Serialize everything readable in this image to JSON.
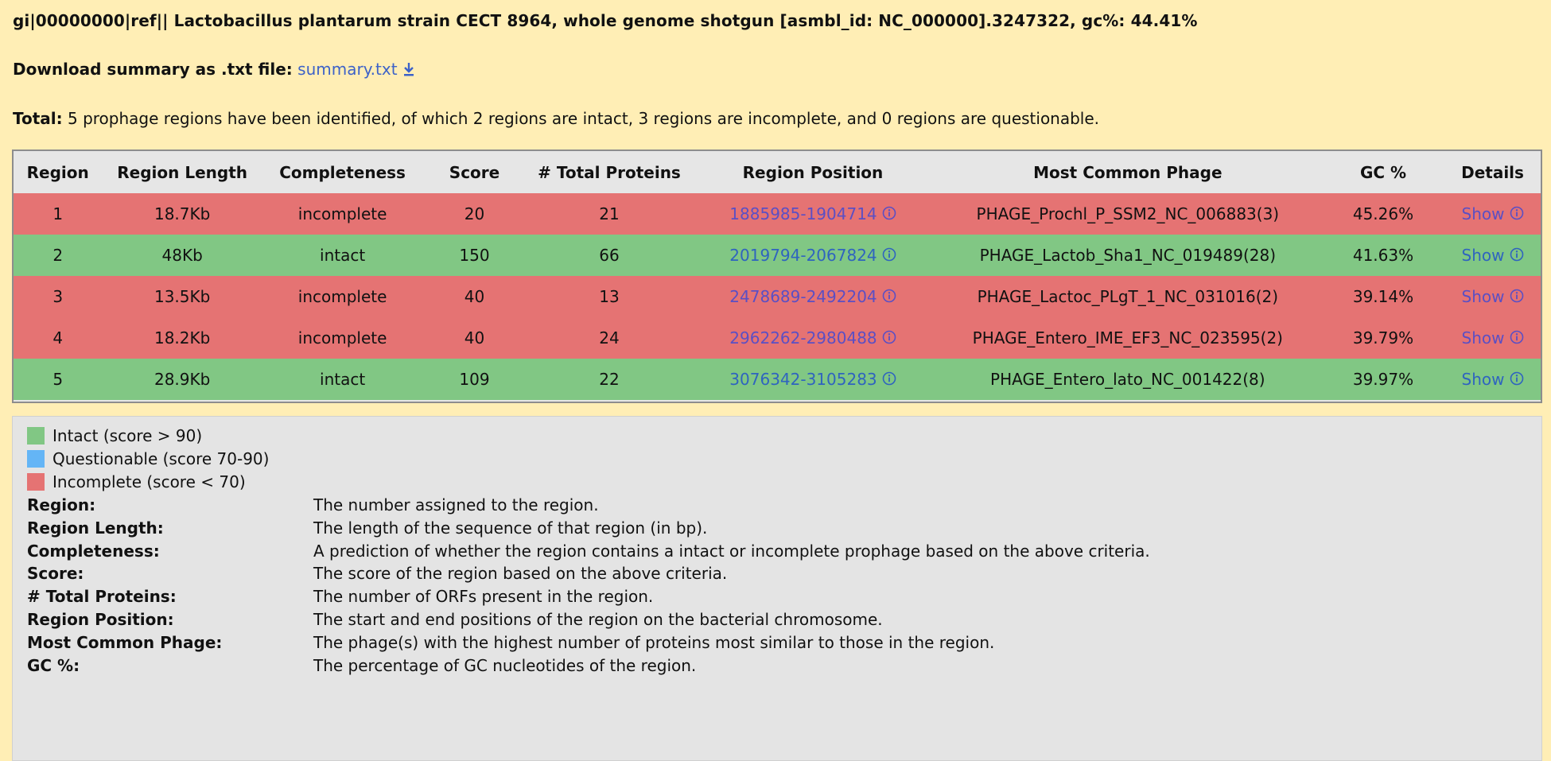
{
  "header": {
    "title": "gi|00000000|ref|| Lactobacillus plantarum strain CECT 8964, whole genome shotgun [asmbl_id: NC_000000].3247322, gc%: 44.41%",
    "download_label": "Download summary as .txt file:",
    "download_link": "summary.txt",
    "total_label": "Total:",
    "total_text": " 5 prophage regions have been identified, of which 2 regions are intact, 3 regions are incomplete, and 0 regions are questionable."
  },
  "table": {
    "columns": [
      "Region",
      "Region Length",
      "Completeness",
      "Score",
      "# Total Proteins",
      "Region Position",
      "Most Common Phage",
      "GC %",
      "Details"
    ],
    "rows": [
      {
        "region": "1",
        "length": "18.7Kb",
        "completeness": "incomplete",
        "score": "20",
        "proteins": "21",
        "position": "1885985-1904714",
        "phage": "PHAGE_Prochl_P_SSM2_NC_006883(3)",
        "gc": "45.26%",
        "details": "Show",
        "status": "incomplete"
      },
      {
        "region": "2",
        "length": "48Kb",
        "completeness": "intact",
        "score": "150",
        "proteins": "66",
        "position": "2019794-2067824",
        "phage": "PHAGE_Lactob_Sha1_NC_019489(28)",
        "gc": "41.63%",
        "details": "Show",
        "status": "intact"
      },
      {
        "region": "3",
        "length": "13.5Kb",
        "completeness": "incomplete",
        "score": "40",
        "proteins": "13",
        "position": "2478689-2492204",
        "phage": "PHAGE_Lactoc_PLgT_1_NC_031016(2)",
        "gc": "39.14%",
        "details": "Show",
        "status": "incomplete"
      },
      {
        "region": "4",
        "length": "18.2Kb",
        "completeness": "incomplete",
        "score": "40",
        "proteins": "24",
        "position": "2962262-2980488",
        "phage": "PHAGE_Entero_IME_EF3_NC_023595(2)",
        "gc": "39.79%",
        "details": "Show",
        "status": "incomplete"
      },
      {
        "region": "5",
        "length": "28.9Kb",
        "completeness": "intact",
        "score": "109",
        "proteins": "22",
        "position": "3076342-3105283",
        "phage": "PHAGE_Entero_lato_NC_001422(8)",
        "gc": "39.97%",
        "details": "Show",
        "status": "intact"
      }
    ]
  },
  "legend": {
    "items": [
      {
        "label": "Intact (score > 90)",
        "color": "#81c784"
      },
      {
        "label": "Questionable (score 70-90)",
        "color": "#64b5f6"
      },
      {
        "label": "Incomplete (score < 70)",
        "color": "#e57373"
      }
    ],
    "definitions": [
      {
        "term": "Region",
        "desc": "The number assigned to the region."
      },
      {
        "term": "Region Length",
        "desc": "The length of the sequence of that region (in bp)."
      },
      {
        "term": "Completeness",
        "desc": "A prediction of whether the region contains a intact or incomplete prophage based on the above criteria."
      },
      {
        "term": "Score",
        "desc": "The score of the region based on the above criteria."
      },
      {
        "term": "# Total Proteins",
        "desc": "The number of ORFs present in the region."
      },
      {
        "term": "Region Position",
        "desc": "The start and end positions of the region on the bacterial chromosome."
      },
      {
        "term": "Most Common Phage",
        "desc": "The phage(s) with the highest number of proteins most similar to those in the region."
      },
      {
        "term": "GC %",
        "desc": "The percentage of GC nucleotides of the region."
      }
    ]
  },
  "colors": {
    "background": "#ffeeb5",
    "intact": "#81c784",
    "incomplete": "#e57373",
    "questionable": "#64b5f6",
    "link": "#3d62c8"
  },
  "icons": {
    "download": "download-icon",
    "info": "info-icon"
  }
}
